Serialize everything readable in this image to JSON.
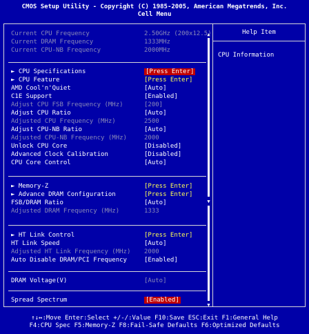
{
  "title": {
    "line1": "CMOS Setup Utility - Copyright (C) 1985-2005, American Megatrends, Inc.",
    "line2": "Cell Menu"
  },
  "help": {
    "header": "Help Item",
    "text": "CPU Information"
  },
  "rows": [
    {
      "label": "Current CPU Frequency",
      "value": "2.50GHz (200x12.5)"
    },
    {
      "label": "Current DRAM Frequency",
      "value": "1333MHz"
    },
    {
      "label": "Current CPU-NB Frequency",
      "value": "2000MHz"
    },
    {
      "label": "► CPU Specifications",
      "value": "[Press Enter]"
    },
    {
      "label": "► CPU Feature",
      "value": "[Press Enter]"
    },
    {
      "label": "AMD Cool'n'Quiet",
      "value": "[Auto]"
    },
    {
      "label": "C1E Support",
      "value": "[Enabled]"
    },
    {
      "label": "Adjust CPU FSB Frequency (MHz)",
      "value": "[200]"
    },
    {
      "label": "Adjust CPU Ratio",
      "value": "[Auto]"
    },
    {
      "label": "Adjusted CPU Frequency (MHz)",
      "value": "2500"
    },
    {
      "label": "Adjust CPU-NB Ratio",
      "value": "[Auto]"
    },
    {
      "label": "Adjusted CPU-NB Frequency (MHz)",
      "value": "2000"
    },
    {
      "label": "Unlock CPU Core",
      "value": "[Disabled]"
    },
    {
      "label": "Advanced Clock Calibration",
      "value": "[Disabled]"
    },
    {
      "label": "CPU Core Control",
      "value": "[Auto]"
    },
    {
      "label": "► Memory-Z",
      "value": "[Press Enter]"
    },
    {
      "label": "► Advance DRAM Configuration",
      "value": "[Press Enter]"
    },
    {
      "label": "FSB/DRAM Ratio",
      "value": "[Auto]"
    },
    {
      "label": "Adjusted DRAM Frequency (MHz)",
      "value": "1333"
    },
    {
      "label": "► HT Link Control",
      "value": "[Press Enter]"
    },
    {
      "label": "HT Link Speed",
      "value": "[Auto]"
    },
    {
      "label": "Adjusted HT Link Frequency (MHz)",
      "value": "2000"
    },
    {
      "label": "Auto Disable DRAM/PCI Frequency",
      "value": "[Enabled]"
    },
    {
      "label": "DRAM Voltage(V)",
      "value": "[Auto]"
    },
    {
      "label": "Spread Spectrum",
      "value": "[Enabled]"
    }
  ],
  "footer": {
    "line1": "↑↓↔:Move  Enter:Select  +/-/:Value  F10:Save  ESC:Exit  F1:General Help",
    "line2": "F4:CPU Spec  F5:Memory-Z  F8:Fail-Safe Defaults    F6:Optimized Defaults"
  },
  "colors": {
    "background": "#0000a8",
    "highlight": "#c00000",
    "submenu_value": "#ffff55",
    "dimmed": "#8a8ab8"
  }
}
